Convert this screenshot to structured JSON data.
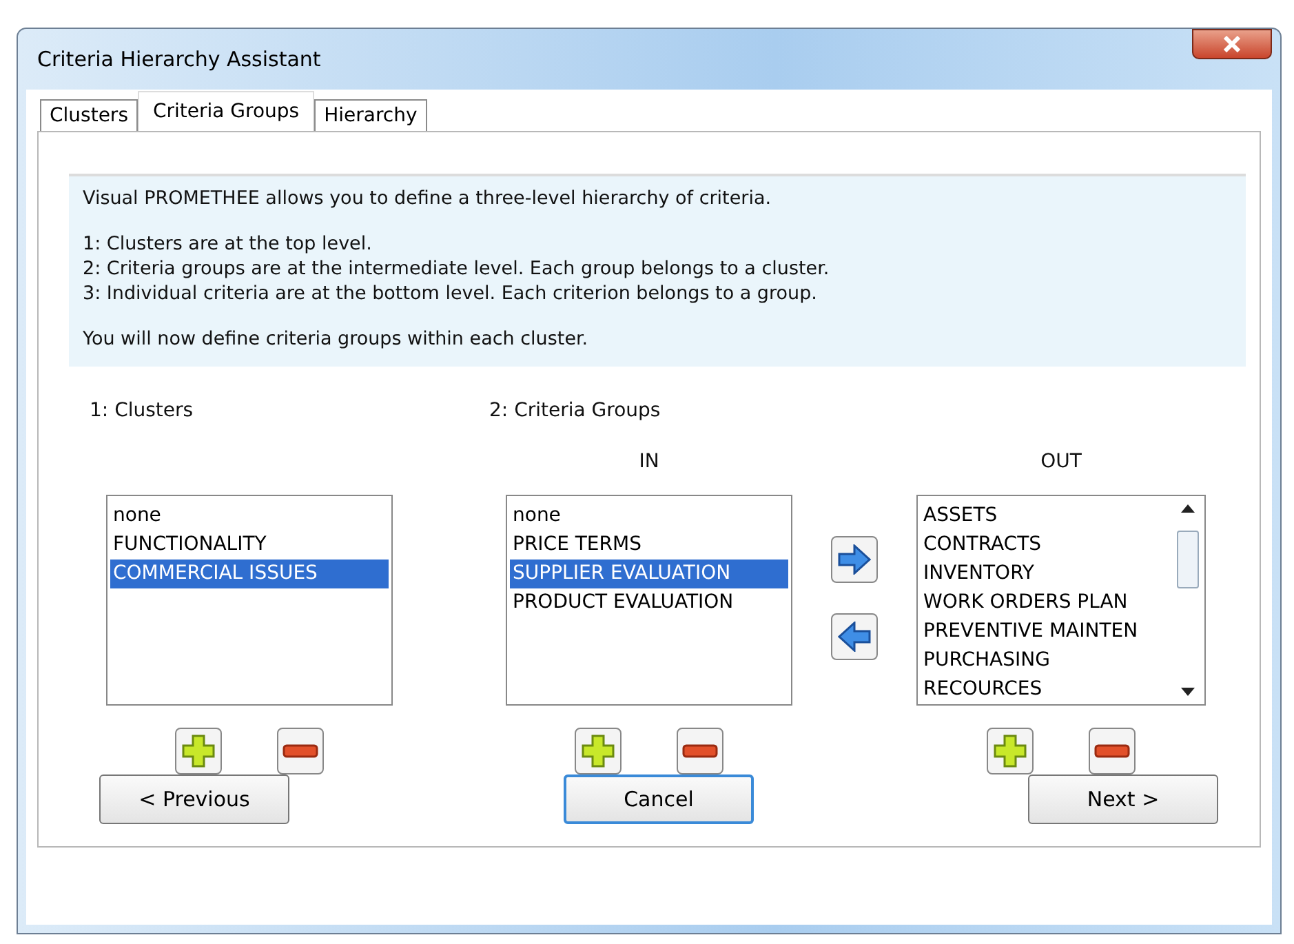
{
  "window": {
    "title": "Criteria Hierarchy Assistant"
  },
  "tabs": [
    {
      "label": "Clusters",
      "selected": false
    },
    {
      "label": "Criteria Groups",
      "selected": true
    },
    {
      "label": "Hierarchy",
      "selected": false
    }
  ],
  "intro": {
    "paragraphs": [
      [
        "Visual PROMETHEE allows you to define a three-level hierarchy of criteria."
      ],
      [
        "1: Clusters are at the top level.",
        "2: Criteria groups are at the intermediate level. Each group belongs to a cluster.",
        "3: Individual criteria are at the bottom level. Each criterion belongs to a group."
      ],
      [
        "You will now define criteria groups within each cluster."
      ]
    ]
  },
  "clusters": {
    "label": "1: Clusters",
    "items": [
      {
        "text": "none",
        "selected": false
      },
      {
        "text": "FUNCTIONALITY",
        "selected": false
      },
      {
        "text": "COMMERCIAL ISSUES",
        "selected": true
      }
    ]
  },
  "criteria_groups": {
    "label": "2: Criteria Groups",
    "in": {
      "label": "IN",
      "items": [
        {
          "text": "none",
          "selected": false
        },
        {
          "text": "PRICE TERMS",
          "selected": false
        },
        {
          "text": "SUPPLIER EVALUATION",
          "selected": true
        },
        {
          "text": "PRODUCT EVALUATION",
          "selected": false
        }
      ]
    },
    "out": {
      "label": "OUT",
      "items": [
        {
          "text": "ASSETS",
          "selected": false
        },
        {
          "text": "CONTRACTS",
          "selected": false
        },
        {
          "text": "INVENTORY",
          "selected": false
        },
        {
          "text": "WORK ORDERS PLAN",
          "selected": false
        },
        {
          "text": "PREVENTIVE MAINTEN",
          "selected": false
        },
        {
          "text": "PURCHASING",
          "selected": false
        },
        {
          "text": "RECOURCES",
          "selected": false
        }
      ]
    }
  },
  "buttons": [
    {
      "label": "< Previous",
      "default": false
    },
    {
      "label": "Cancel",
      "default": true
    },
    {
      "label": "Next >",
      "default": false
    }
  ]
}
